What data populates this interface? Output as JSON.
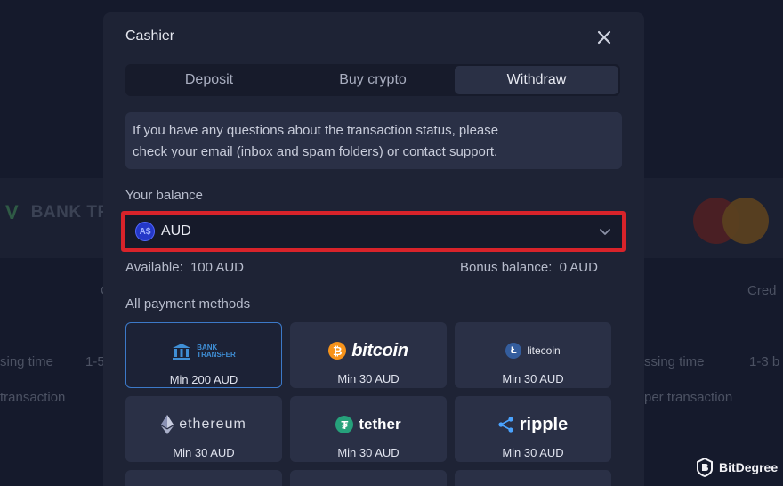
{
  "background": {
    "bank_logo_text": "BANK TRANSFER",
    "bank_logo_short": "BANK TRANS",
    "left_texts": [
      "sing time",
      "1-5",
      "transaction"
    ],
    "right_texts": [
      "Cred",
      "ssing time",
      "1-3 b",
      "per transaction"
    ],
    "left_label_c": "C"
  },
  "modal": {
    "title": "Cashier",
    "tabs": [
      {
        "label": "Deposit",
        "active": false
      },
      {
        "label": "Buy crypto",
        "active": false
      },
      {
        "label": "Withdraw",
        "active": true
      }
    ],
    "info_line1": "If you have any questions about the transaction status, please",
    "info_line2": "check your email (inbox and spam folders) or contact support.",
    "balance_label": "Your balance",
    "currency": {
      "icon_text": "A$",
      "value": "AUD"
    },
    "available_label": "Available:",
    "available_value": "100 AUD",
    "bonus_label": "Bonus balance:",
    "bonus_value": "0 AUD",
    "methods_label": "All payment methods",
    "methods": [
      {
        "name": "BANK TRANSFER",
        "logo_line1": "BANK",
        "logo_line2": "TRANSFER",
        "min": "Min 200 AUD",
        "selected": true
      },
      {
        "name": "bitcoin",
        "icon": "₿",
        "min": "Min 30 AUD",
        "selected": false
      },
      {
        "name": "litecoin",
        "icon": "Ł",
        "min": "Min 30 AUD",
        "selected": false
      },
      {
        "name": "ethereum",
        "min": "Min 30 AUD",
        "selected": false
      },
      {
        "name": "tether",
        "icon": "₮",
        "min": "Min 30 AUD",
        "selected": false
      },
      {
        "name": "ripple",
        "min": "Min 30 AUD",
        "selected": false
      }
    ]
  },
  "watermark": "BitDegree",
  "colors": {
    "highlight_border": "#d8232a",
    "selected_card_border": "#3c79c8",
    "bitcoin": "#f7931a",
    "litecoin": "#345d9d",
    "tether": "#26a17b"
  }
}
